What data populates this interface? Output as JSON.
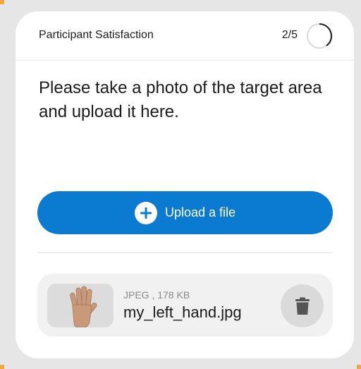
{
  "header": {
    "title": "Participant Satisfaction",
    "progress": "2/5",
    "progress_fraction": 0.4
  },
  "prompt": {
    "text": "Please take a photo of the target area and upload it here."
  },
  "upload": {
    "label": "Upload a file",
    "icon": "plus-circle-icon"
  },
  "file": {
    "meta": "JPEG , 178 KB",
    "name": "my_left_hand.jpg",
    "thumbnail_icon": "hand-photo",
    "delete_icon": "trash-icon"
  },
  "colors": {
    "accent": "#0b7ad1",
    "background": "#e6e6e6",
    "card": "#ffffff"
  }
}
